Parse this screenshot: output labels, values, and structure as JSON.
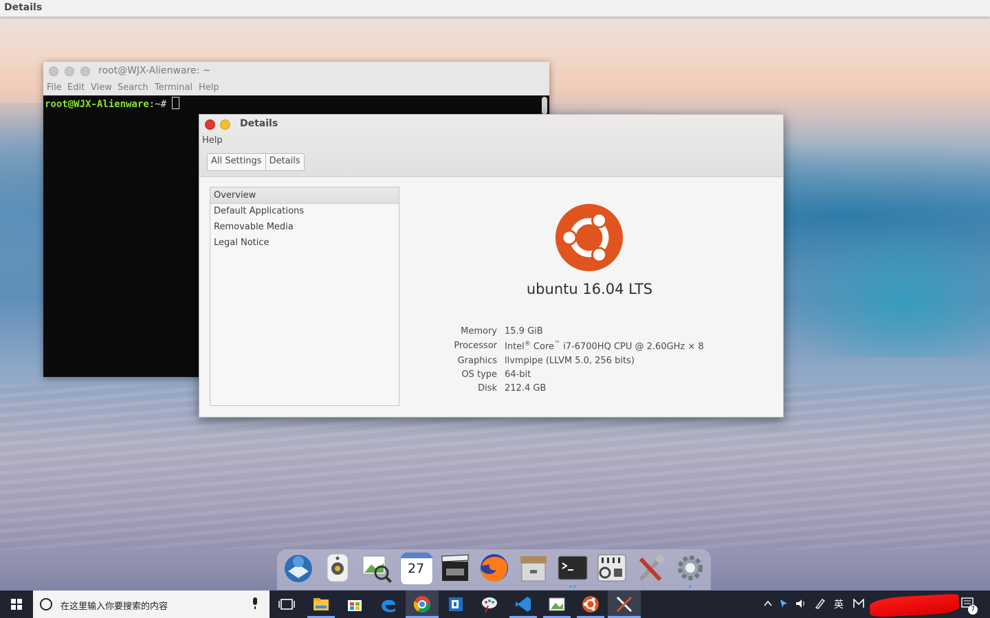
{
  "topbar": {
    "title": "Details"
  },
  "terminal": {
    "title": "root@WJX-Alienware: ~",
    "menu": [
      "File",
      "Edit",
      "View",
      "Search",
      "Terminal",
      "Help"
    ],
    "prompt_user": "root@WJX-Alienware",
    "prompt_rest": ":~# "
  },
  "details": {
    "title": "Details",
    "menu_help": "Help",
    "breadcrumbs": [
      "All Settings",
      "Details"
    ],
    "sidebar": [
      "Overview",
      "Default Applications",
      "Removable Media",
      "Legal Notice"
    ],
    "os_name": "ubuntu 16.04 LTS",
    "info": {
      "memory_label": "Memory",
      "memory_value": "15.9 GiB",
      "processor_label": "Processor",
      "processor_intel": "Intel",
      "processor_reg": "®",
      "processor_core": " Core",
      "processor_tm": "™",
      "processor_rest": " i7-6700HQ CPU @ 2.60GHz × 8",
      "graphics_label": "Graphics",
      "graphics_value": "llvmpipe (LLVM 5.0, 256 bits)",
      "ostype_label": "OS type",
      "ostype_value": "64-bit",
      "disk_label": "Disk",
      "disk_value": "212.4 GB"
    }
  },
  "dock": {
    "calendar_day": "27",
    "icons": [
      "thunderbird-icon",
      "speaker-icon",
      "image-viewer-icon",
      "calendar-icon",
      "video-icon",
      "firefox-icon",
      "archive-icon",
      "terminal-icon",
      "mixer-icon",
      "tools-icon",
      "settings-gear-icon"
    ]
  },
  "taskbar": {
    "search_placeholder": "在这里输入你要搜索的内容",
    "ime_label": "英",
    "notification_count": "7",
    "colors": {
      "background": "#1f2430",
      "accent": "#7aa6ff"
    }
  }
}
